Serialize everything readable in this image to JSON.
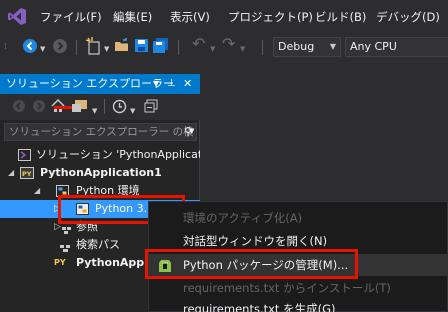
{
  "menubar": {
    "items": [
      "ファイル(F)",
      "編集(E)",
      "表示(V)",
      "プロジェクト(P)",
      "ビルド(B)",
      "デバッグ(D)"
    ]
  },
  "toolbar": {
    "config": "Debug",
    "platform": "Any CPU"
  },
  "solution_explorer": {
    "title": "ソリューション エクスプローラー",
    "search_placeholder": "ソリューション エクスプローラー の検",
    "tree": {
      "solution": "ソリューション 'PythonApplication",
      "project": "PythonApplication1",
      "env_folder": "Python 環境",
      "env_item": "Python 3.",
      "references": "参照",
      "search_paths": "検索パス",
      "py_file": "PythonApplic"
    }
  },
  "context_menu": {
    "items": [
      {
        "label": "環境のアクティブ化(A)",
        "enabled": false
      },
      {
        "label": "対話型ウィンドウを開く(N)",
        "enabled": true
      },
      {
        "label": "Python パッケージの管理(M)...",
        "enabled": true
      },
      {
        "label": "requirements.txt からインストール(T)",
        "enabled": false
      },
      {
        "label": "requirements.txt を生成(G)",
        "enabled": true
      }
    ]
  },
  "colors": {
    "accent": "#007acc",
    "selection": "#3399ff",
    "highlight_box": "#e51400",
    "vs_purple": "#865fc5"
  }
}
